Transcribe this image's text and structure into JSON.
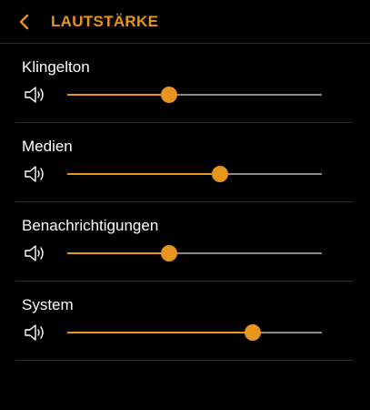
{
  "header": {
    "title": "LAUTSTÄRKE",
    "back_icon": "chevron-left-icon"
  },
  "accent_color": "#e8951f",
  "sections": [
    {
      "label": "Klingelton",
      "icon": "speaker-icon",
      "level": 0.4
    },
    {
      "label": "Medien",
      "icon": "speaker-icon",
      "level": 0.6
    },
    {
      "label": "Benachrichtigungen",
      "icon": "speaker-icon",
      "level": 0.4
    },
    {
      "label": "System",
      "icon": "speaker-icon",
      "level": 0.73
    }
  ]
}
